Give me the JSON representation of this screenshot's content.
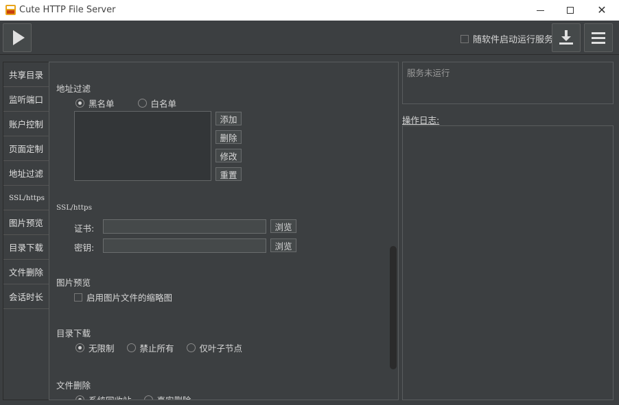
{
  "window": {
    "title": "Cute HTTP File Server",
    "icon": "app-logo"
  },
  "toolbar": {
    "autostart_label": "随软件启动运行服务",
    "autostart_checked": false
  },
  "nav": {
    "items": [
      {
        "label": "共享目录"
      },
      {
        "label": "监听端口"
      },
      {
        "label": "账户控制"
      },
      {
        "label": "页面定制"
      },
      {
        "label": "地址过滤"
      },
      {
        "label": "SSL/https"
      },
      {
        "label": "图片预览"
      },
      {
        "label": "目录下载"
      },
      {
        "label": "文件删除"
      },
      {
        "label": "会话时长"
      }
    ],
    "active": "账户控制"
  },
  "address_filter": {
    "title": "地址过滤",
    "blacklist_label": "黑名单",
    "whitelist_label": "白名单",
    "selected": "blacklist",
    "add_label": "添加",
    "delete_label": "删除",
    "edit_label": "修改",
    "reset_label": "重置"
  },
  "ssl": {
    "title": "SSL/https",
    "cert_label": "证书:",
    "cert_value": "",
    "key_label": "密钥:",
    "key_value": "",
    "browse_label": "浏览"
  },
  "image_preview": {
    "title": "图片预览",
    "thumbnail_label": "启用图片文件的缩略图",
    "thumbnail_checked": false
  },
  "dir_download": {
    "title": "目录下载",
    "unlimited_label": "无限制",
    "forbid_all_label": "禁止所有",
    "leaf_only_label": "仅叶子节点",
    "selected": "unlimited"
  },
  "file_delete": {
    "title": "文件删除",
    "recycle_label": "系统回收站",
    "real_delete_label": "真实删除",
    "selected": "recycle"
  },
  "status": {
    "text": "服务未运行"
  },
  "log": {
    "label": "操作日志:"
  }
}
